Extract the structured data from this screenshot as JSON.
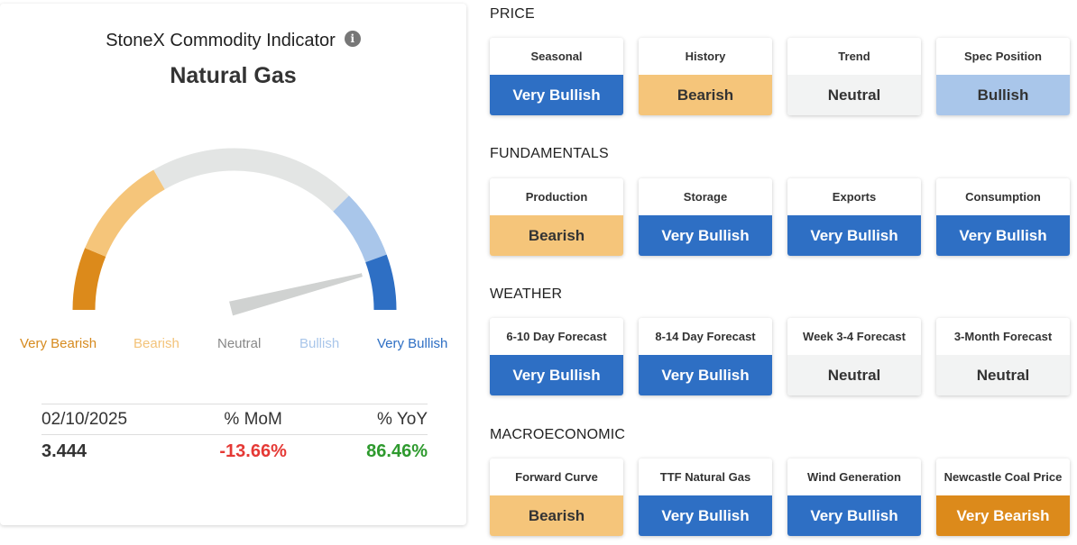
{
  "indicator": {
    "title": "StoneX Commodity Indicator",
    "commodity": "Natural Gas",
    "gauge_level_fraction": 0.92,
    "gauge_labels": {
      "very_bearish": "Very Bearish",
      "bearish": "Bearish",
      "neutral": "Neutral",
      "bullish": "Bullish",
      "very_bullish": "Very Bullish"
    },
    "colors": {
      "very_bearish": "#dc8a1b",
      "bearish": "#f5c57a",
      "neutral": "#e3e5e4",
      "bullish": "#a9c6ea",
      "very_bullish": "#2e6fc4",
      "needle": "#d0d2d1"
    },
    "stats": {
      "date": "02/10/2025",
      "mom_header": "% MoM",
      "yoy_header": "% YoY",
      "price": "3.444",
      "mom": "-13.66%",
      "yoy": "86.46%"
    }
  },
  "sections": [
    {
      "title": "PRICE",
      "tiles": [
        {
          "label": "Seasonal",
          "status": "Very Bullish",
          "level": "vbull"
        },
        {
          "label": "History",
          "status": "Bearish",
          "level": "bear"
        },
        {
          "label": "Trend",
          "status": "Neutral",
          "level": "neu"
        },
        {
          "label": "Spec Position",
          "status": "Bullish",
          "level": "bull"
        }
      ]
    },
    {
      "title": "FUNDAMENTALS",
      "tiles": [
        {
          "label": "Production",
          "status": "Bearish",
          "level": "bear"
        },
        {
          "label": "Storage",
          "status": "Very Bullish",
          "level": "vbull"
        },
        {
          "label": "Exports",
          "status": "Very Bullish",
          "level": "vbull"
        },
        {
          "label": "Consumption",
          "status": "Very Bullish",
          "level": "vbull"
        }
      ]
    },
    {
      "title": "WEATHER",
      "tiles": [
        {
          "label": "6-10 Day Forecast",
          "status": "Very Bullish",
          "level": "vbull"
        },
        {
          "label": "8-14 Day Forecast",
          "status": "Very Bullish",
          "level": "vbull"
        },
        {
          "label": "Week 3-4 Forecast",
          "status": "Neutral",
          "level": "neu"
        },
        {
          "label": "3-Month Forecast",
          "status": "Neutral",
          "level": "neu"
        }
      ]
    },
    {
      "title": "MACROECONOMIC",
      "tiles": [
        {
          "label": "Forward Curve",
          "status": "Bearish",
          "level": "bear"
        },
        {
          "label": "TTF Natural Gas",
          "status": "Very Bullish",
          "level": "vbull"
        },
        {
          "label": "Wind Generation",
          "status": "Very Bullish",
          "level": "vbull"
        },
        {
          "label": "Newcastle Coal Price",
          "status": "Very Bearish",
          "level": "vbear"
        }
      ]
    }
  ]
}
